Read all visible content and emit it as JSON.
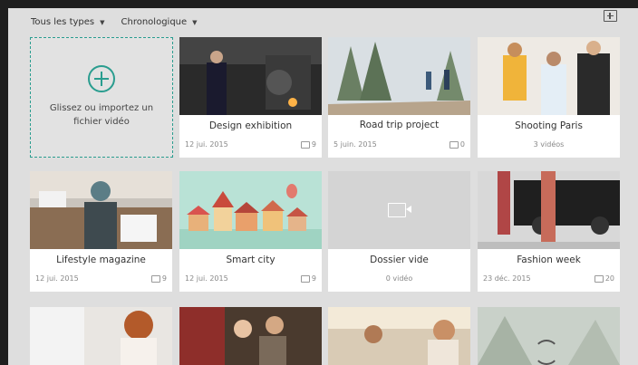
{
  "toolbar": {
    "filter_label": "Tous les types",
    "sort_label": "Chronologique"
  },
  "upload": {
    "line1": "Glissez ou importez un",
    "line2": "fichier vidéo"
  },
  "cards": [
    {
      "title": "Design exhibition",
      "date": "12 jui. 2015",
      "comments": "9"
    },
    {
      "title": "Road trip project",
      "date": "5 juin. 2015",
      "comments": "0"
    },
    {
      "title": "Shooting Paris",
      "subtitle": "3 vidéos"
    },
    {
      "title": "Lifestyle magazine",
      "date": "12 jui. 2015",
      "comments": "9"
    },
    {
      "title": "Smart city",
      "date": "12 jui. 2015",
      "comments": "9"
    },
    {
      "title": "Dossier vide",
      "subtitle": "0 vidéo"
    },
    {
      "title": "Fashion week",
      "date": "23 déc. 2015",
      "comments": "20"
    }
  ],
  "colors": {
    "accent": "#2a9d8f",
    "background": "#dedede"
  }
}
